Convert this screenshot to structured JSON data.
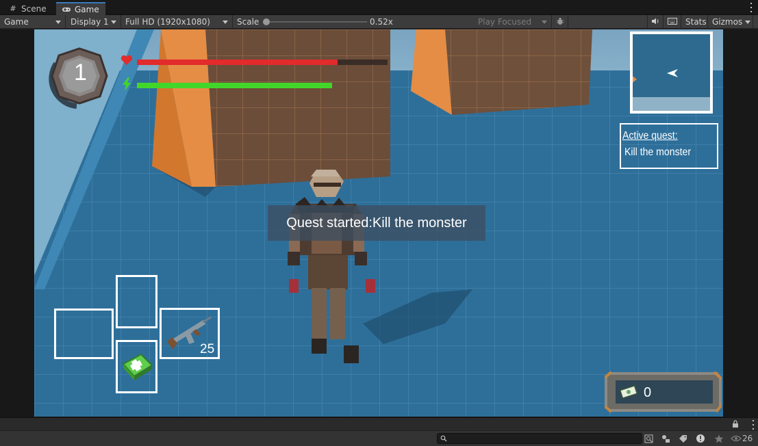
{
  "tabs": [
    {
      "label": "Scene",
      "icon": "grid-icon"
    },
    {
      "label": "Game",
      "icon": "gamepad-icon"
    }
  ],
  "toolbar": {
    "display_mode": "Game",
    "display": "Display 1",
    "resolution": "Full HD (1920x1080)",
    "scale_label": "Scale",
    "scale_value": "0.52x",
    "play_mode": "Play Focused",
    "stats_label": "Stats",
    "gizmos_label": "Gizmos"
  },
  "hud": {
    "level": "1",
    "health_fraction": 0.8,
    "energy_fraction": 0.78,
    "quest_popup": "Quest started:Kill the monster",
    "active_quest_title": "Active quest:",
    "active_quest_name": "Kill the monster",
    "ammo_count": "25",
    "money": "0",
    "colors": {
      "health": "#e22b2b",
      "energy": "#43d62a",
      "floor": "#2f6f98",
      "box": "#a4652f"
    }
  },
  "statusbar": {
    "visible_count": "26"
  }
}
